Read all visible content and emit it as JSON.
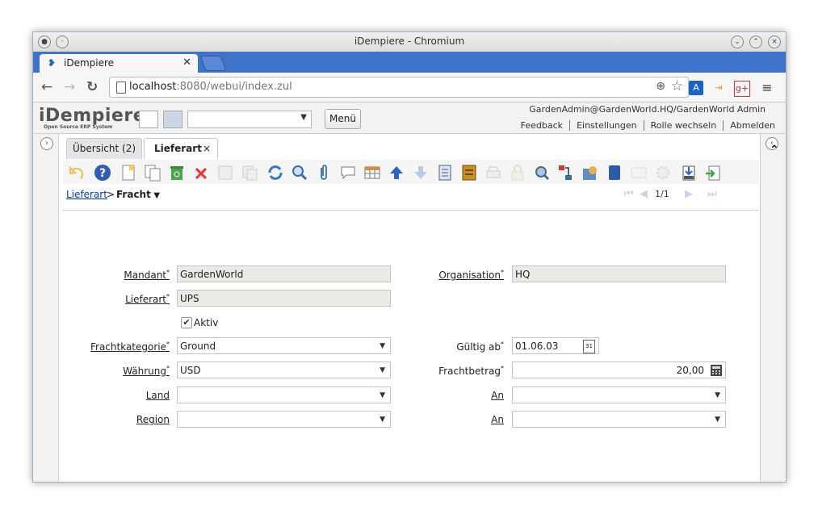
{
  "browser": {
    "window_title": "iDempiere - Chromium",
    "tab_label": "iDempiere",
    "url_host": "localhost",
    "url_rest": ":8080/webui/index.zul"
  },
  "app": {
    "logo": "iDempiere",
    "logo_sub": "Open Source ERP System",
    "menu_button": "Menü",
    "user": "GardenAdmin@GardenWorld.HQ/GardenWorld Admin",
    "links": [
      "Feedback",
      "Einstellungen",
      "Rolle wechseln",
      "Abmelden"
    ]
  },
  "tabs": [
    {
      "label": "Übersicht (2)"
    },
    {
      "label": "Lieferart",
      "close": "×"
    }
  ],
  "breadcrumb": {
    "parent": "Lieferart",
    "separator": ">",
    "current": "Fracht"
  },
  "pager": {
    "text": "1/1"
  },
  "form": {
    "mandant_label": "Mandant",
    "mandant_value": "GardenWorld",
    "organisation_label": "Organisation",
    "organisation_value": "HQ",
    "lieferart_label": "Lieferart",
    "lieferart_value": "UPS",
    "aktiv_label": "Aktiv",
    "frachtkategorie_label": "Frachtkategorie",
    "frachtkategorie_value": "Ground",
    "gueltig_label": "Gültig ab",
    "gueltig_value": "01.06.03",
    "waehrung_label": "Währung",
    "waehrung_value": "USD",
    "frachtbetrag_label": "Frachtbetrag",
    "frachtbetrag_value": "20,00",
    "land_label": "Land",
    "land_value": "",
    "an1_label": "An",
    "an1_value": "",
    "region_label": "Region",
    "region_value": "",
    "an2_label": "An",
    "an2_value": "",
    "required_mark": "*",
    "calendar_day": "31"
  },
  "colors": {
    "browser_tabstrip": "#3f73c9",
    "link": "#0033cc",
    "readonly_field": "#ebebe6"
  }
}
